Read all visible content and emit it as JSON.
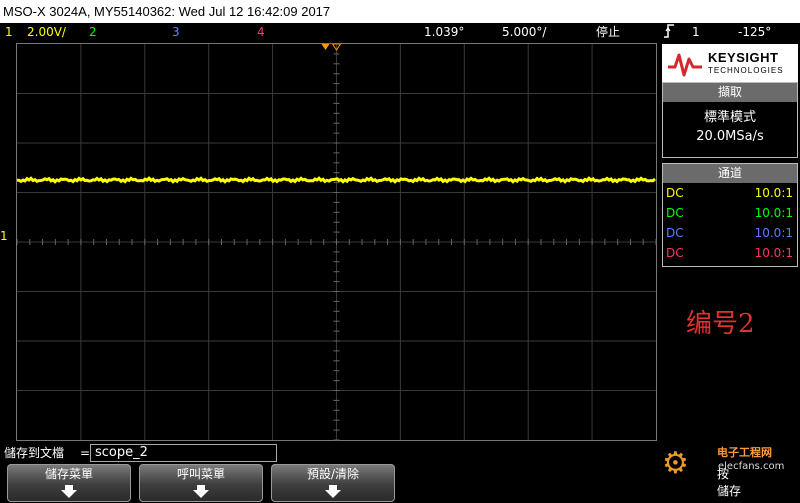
{
  "title_bar": {
    "text": "MSO-X 3024A, MY55140362: Wed Jul 12 16:42:09 2017"
  },
  "status_bar": {
    "ch1_number": "1",
    "ch1_scale": "2.00V/",
    "ch2_number": "2",
    "ch3_number": "3",
    "ch4_number": "4",
    "time_position": "1.039°",
    "time_scale": "5.000°/",
    "run_state": "停止",
    "trigger_icon": "trigger-edge-icon",
    "trigger_source": "1",
    "trigger_level": "-125°"
  },
  "screen": {
    "ground_marker": "1",
    "trace_color": "#ffff00"
  },
  "logo": {
    "brand": "KEYSIGHT",
    "sub": "TECHNOLOGIES"
  },
  "acquisition": {
    "header": "擷取",
    "mode": "標準模式",
    "sample_rate": "20.0MSa/s"
  },
  "channels": {
    "header": "通道",
    "rows": [
      {
        "coupling": "DC",
        "probe": "10.0:1",
        "color": "#ffff00"
      },
      {
        "coupling": "DC",
        "probe": "10.0:1",
        "color": "#00ff00"
      },
      {
        "coupling": "DC",
        "probe": "10.0:1",
        "color": "#5a7bff"
      },
      {
        "coupling": "DC",
        "probe": "10.0:1",
        "color": "#ff3366"
      }
    ]
  },
  "annotation": {
    "text": "编号2"
  },
  "save": {
    "label": "儲存到文檔",
    "equals": "=",
    "filename": "scope_2"
  },
  "softkeys": [
    {
      "label": "儲存菜單"
    },
    {
      "label": "呼叫菜單"
    },
    {
      "label": "預設/清除"
    }
  ],
  "watermark": {
    "title": "电子工程网",
    "url": "elecfans.com",
    "char1": "按",
    "char2": "儲存"
  }
}
